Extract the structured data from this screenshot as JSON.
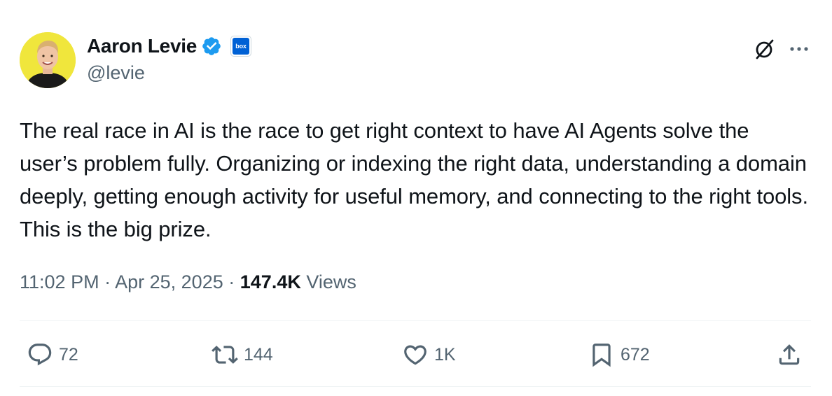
{
  "author": {
    "display_name": "Aaron Levie",
    "handle": "@levie",
    "verified": true,
    "affiliate_badge_text": "box",
    "avatar_icon": "profile-photo"
  },
  "tweet": {
    "text": "The real race in AI is the race to get right context to have AI Agents solve the user’s problem fully. Organizing or indexing the right data, understanding a domain deeply, getting enough activity for useful memory, and connecting to the right tools. This is the big prize.",
    "time": "11:02 PM",
    "separator": "·",
    "date": "Apr 25, 2025",
    "views_count": "147.4K",
    "views_label": "Views"
  },
  "actions": {
    "replies": "72",
    "reposts": "144",
    "likes": "1K",
    "bookmarks": "672"
  },
  "icons": {
    "top_right": [
      "grok-icon",
      "more-icon"
    ],
    "action_bar": [
      "reply-icon",
      "repost-icon",
      "like-icon",
      "bookmark-icon",
      "share-icon"
    ]
  },
  "colors": {
    "text_primary": "#0f1419",
    "text_secondary": "#536471",
    "verified_blue": "#1d9bf0",
    "box_brand": "#0061d5",
    "divider": "#eff3f4",
    "avatar_background": "#f0e63c"
  }
}
